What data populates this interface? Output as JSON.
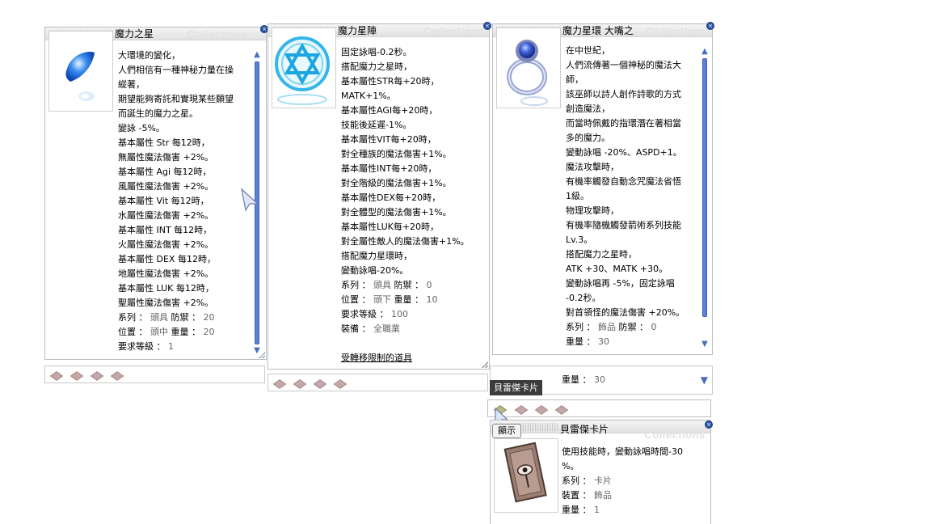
{
  "watermark": "Collections",
  "win1": {
    "title": "魔力之星",
    "lines": [
      {
        "t": "大環境的變化，"
      },
      {
        "t": "人們相信有一種神秘力量在操"
      },
      {
        "t": "縱著，"
      },
      {
        "t": "期望能夠寄託和實現某些願望"
      },
      {
        "t": "而誕生的魔力之星。"
      },
      {
        "t": "變詠 -5%。"
      },
      {
        "t": "基本屬性 Str 每12時，"
      },
      {
        "t": "無屬性魔法傷害 +2%。"
      },
      {
        "t": "基本屬性 Agi 每12時，"
      },
      {
        "t": "風屬性魔法傷害 +2%。"
      },
      {
        "t": "基本屬性 Vit 每12時，"
      },
      {
        "t": "水屬性魔法傷害 +2%。"
      },
      {
        "t": "基本屬性 INT 每12時，"
      },
      {
        "t": "火屬性魔法傷害 +2%。"
      },
      {
        "t": "基本屬性 DEX 每12時，"
      },
      {
        "t": "地屬性魔法傷害 +2%。"
      },
      {
        "t": "基本屬性 LUK 每12時，"
      },
      {
        "t": "聖屬性魔法傷害 +2%。"
      }
    ],
    "props": [
      [
        {
          "t": "系列 ： ",
          "g": false
        },
        {
          "t": "頭具",
          "g": true
        },
        {
          "t": " 防禦 ： ",
          "g": false
        },
        {
          "t": "20",
          "g": true
        }
      ],
      [
        {
          "t": "位置 ： ",
          "g": false
        },
        {
          "t": "頭中",
          "g": true
        },
        {
          "t": "  重量 ： ",
          "g": false
        },
        {
          "t": "20",
          "g": true
        }
      ],
      [
        {
          "t": "要求等級 ： ",
          "g": false
        },
        {
          "t": "1",
          "g": true
        }
      ]
    ]
  },
  "win2": {
    "title": "魔力星陣",
    "lines": [
      {
        "t": "固定詠唱-0.2秒。"
      },
      {
        "t": "搭配魔力之星時，"
      },
      {
        "t": "基本屬性STR每+20時，"
      },
      {
        "t": "MATK+1%。"
      },
      {
        "t": "基本屬性AGI每+20時，"
      },
      {
        "t": "技能後延遲-1%。"
      },
      {
        "t": "基本屬性VIT每+20時，"
      },
      {
        "t": "對全種族的魔法傷害+1%。"
      },
      {
        "t": "基本屬性INT每+20時，"
      },
      {
        "t": "對全階級的魔法傷害+1%。"
      },
      {
        "t": "基本屬性DEX每+20時，"
      },
      {
        "t": "對全體型的魔法傷害+1%。"
      },
      {
        "t": "基本屬性LUK每+20時，"
      },
      {
        "t": "對全屬性敵人的魔法傷害+1%。"
      },
      {
        "t": "搭配魔力星環時，"
      },
      {
        "t": "變動詠唱-20%。"
      }
    ],
    "props": [
      [
        {
          "t": "系列 ： ",
          "g": false
        },
        {
          "t": "頭具",
          "g": true
        },
        {
          "t": " 防禦 ： ",
          "g": false
        },
        {
          "t": "0",
          "g": true
        }
      ],
      [
        {
          "t": "位置 ： ",
          "g": false
        },
        {
          "t": "頭下",
          "g": true
        },
        {
          "t": " 重量 ： ",
          "g": false
        },
        {
          "t": "10",
          "g": true
        }
      ],
      [
        {
          "t": "要求等級 ： ",
          "g": false
        },
        {
          "t": "100",
          "g": true
        }
      ],
      [
        {
          "t": "裝備 ： ",
          "g": false
        },
        {
          "t": "全職業",
          "g": true
        }
      ]
    ],
    "link": "受轉移限制的道具"
  },
  "win3": {
    "title": "魔力星環 大嘴之",
    "lines": [
      {
        "t": "在中世紀，"
      },
      {
        "t": "人們流傳著一個神秘的魔法大"
      },
      {
        "t": "師，"
      },
      {
        "t": "該巫師以詩人創作詩歌的方式"
      },
      {
        "t": "創造魔法，"
      },
      {
        "t": "而當時佩戴的指環潛在著相當"
      },
      {
        "t": "多的魔力。"
      },
      {
        "t": "變動詠唱 -20%、ASPD+1。"
      },
      {
        "t": "魔法攻擊時，"
      },
      {
        "t": "有機率觸發自動念咒魔法省悟"
      },
      {
        "t": "1級。"
      },
      {
        "t": "物理攻擊時，"
      },
      {
        "t": "有機率隨機觸發箭術系列技能"
      },
      {
        "t": "Lv.3。"
      },
      {
        "t": "搭配魔力之星時，"
      },
      {
        "t": "ATK +30、MATK +30。"
      },
      {
        "t": "變動詠唱再 -5%，固定詠唱"
      },
      {
        "t": "-0.2秒。"
      },
      {
        "t": "對首領怪的魔法傷害 +20%。"
      }
    ],
    "props": [
      [
        {
          "t": "系列 ： ",
          "g": false
        },
        {
          "t": "飾品",
          "g": true
        },
        {
          "t": " 防禦 ： ",
          "g": false
        },
        {
          "t": "0",
          "g": true
        }
      ],
      [
        {
          "t": "重量 ： ",
          "g": false
        },
        {
          "t": "30",
          "g": true
        }
      ]
    ]
  },
  "win3b": {
    "weight_label": "重量 ： ",
    "weight_value": "30",
    "tooltip": "貝雷傑卡片"
  },
  "win4": {
    "title": "貝雷傑卡片",
    "show_button": "顯示",
    "lines": [
      {
        "t": "使用技能時，變動詠唱時間-30"
      },
      {
        "t": "%。"
      }
    ],
    "props": [
      [
        {
          "t": "系列 ： ",
          "g": false
        },
        {
          "t": "卡片",
          "g": true
        }
      ],
      [
        {
          "t": "裝置 ： ",
          "g": false
        },
        {
          "t": "飾品",
          "g": true
        }
      ],
      [
        {
          "t": "重量 ： ",
          "g": false
        },
        {
          "t": "1",
          "g": true
        }
      ]
    ]
  },
  "colors": {
    "scroll_blue": "#5a80da",
    "close_blue": "#2d55a6",
    "slot_pink": "#c4a7a7",
    "slot_olive": "#b8ba84",
    "value_gray": "#666666"
  }
}
